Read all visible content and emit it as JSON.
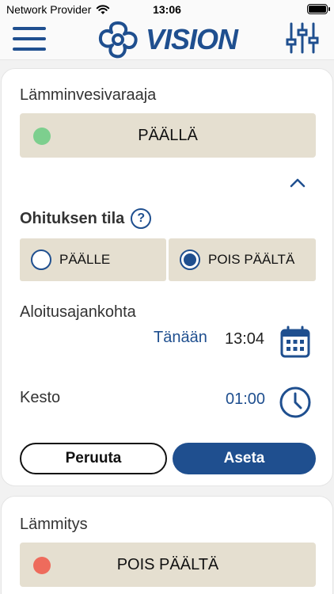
{
  "statusbar": {
    "carrier": "Network Provider",
    "time": "13:06"
  },
  "header": {
    "logo_text": "VISION"
  },
  "water_heater": {
    "title": "Lämminvesivaraaja",
    "status": "PÄÄLLÄ",
    "status_color": "#7dcf8e"
  },
  "override": {
    "title": "Ohituksen tila",
    "help": "?",
    "option_on": "PÄÄLLE",
    "option_off": "POIS PÄÄLTÄ",
    "selected": "POIS PÄÄLTÄ"
  },
  "start": {
    "label": "Aloitusajankohta",
    "day": "Tänään",
    "time": "13:04"
  },
  "duration": {
    "label": "Kesto",
    "value": "01:00"
  },
  "buttons": {
    "cancel": "Peruuta",
    "set": "Aseta"
  },
  "heating": {
    "title": "Lämmitys",
    "status": "POIS PÄÄLTÄ",
    "status_color": "#ee6b5c"
  },
  "colors": {
    "accent": "#1f4f8f",
    "panel": "#e5dfd0"
  }
}
